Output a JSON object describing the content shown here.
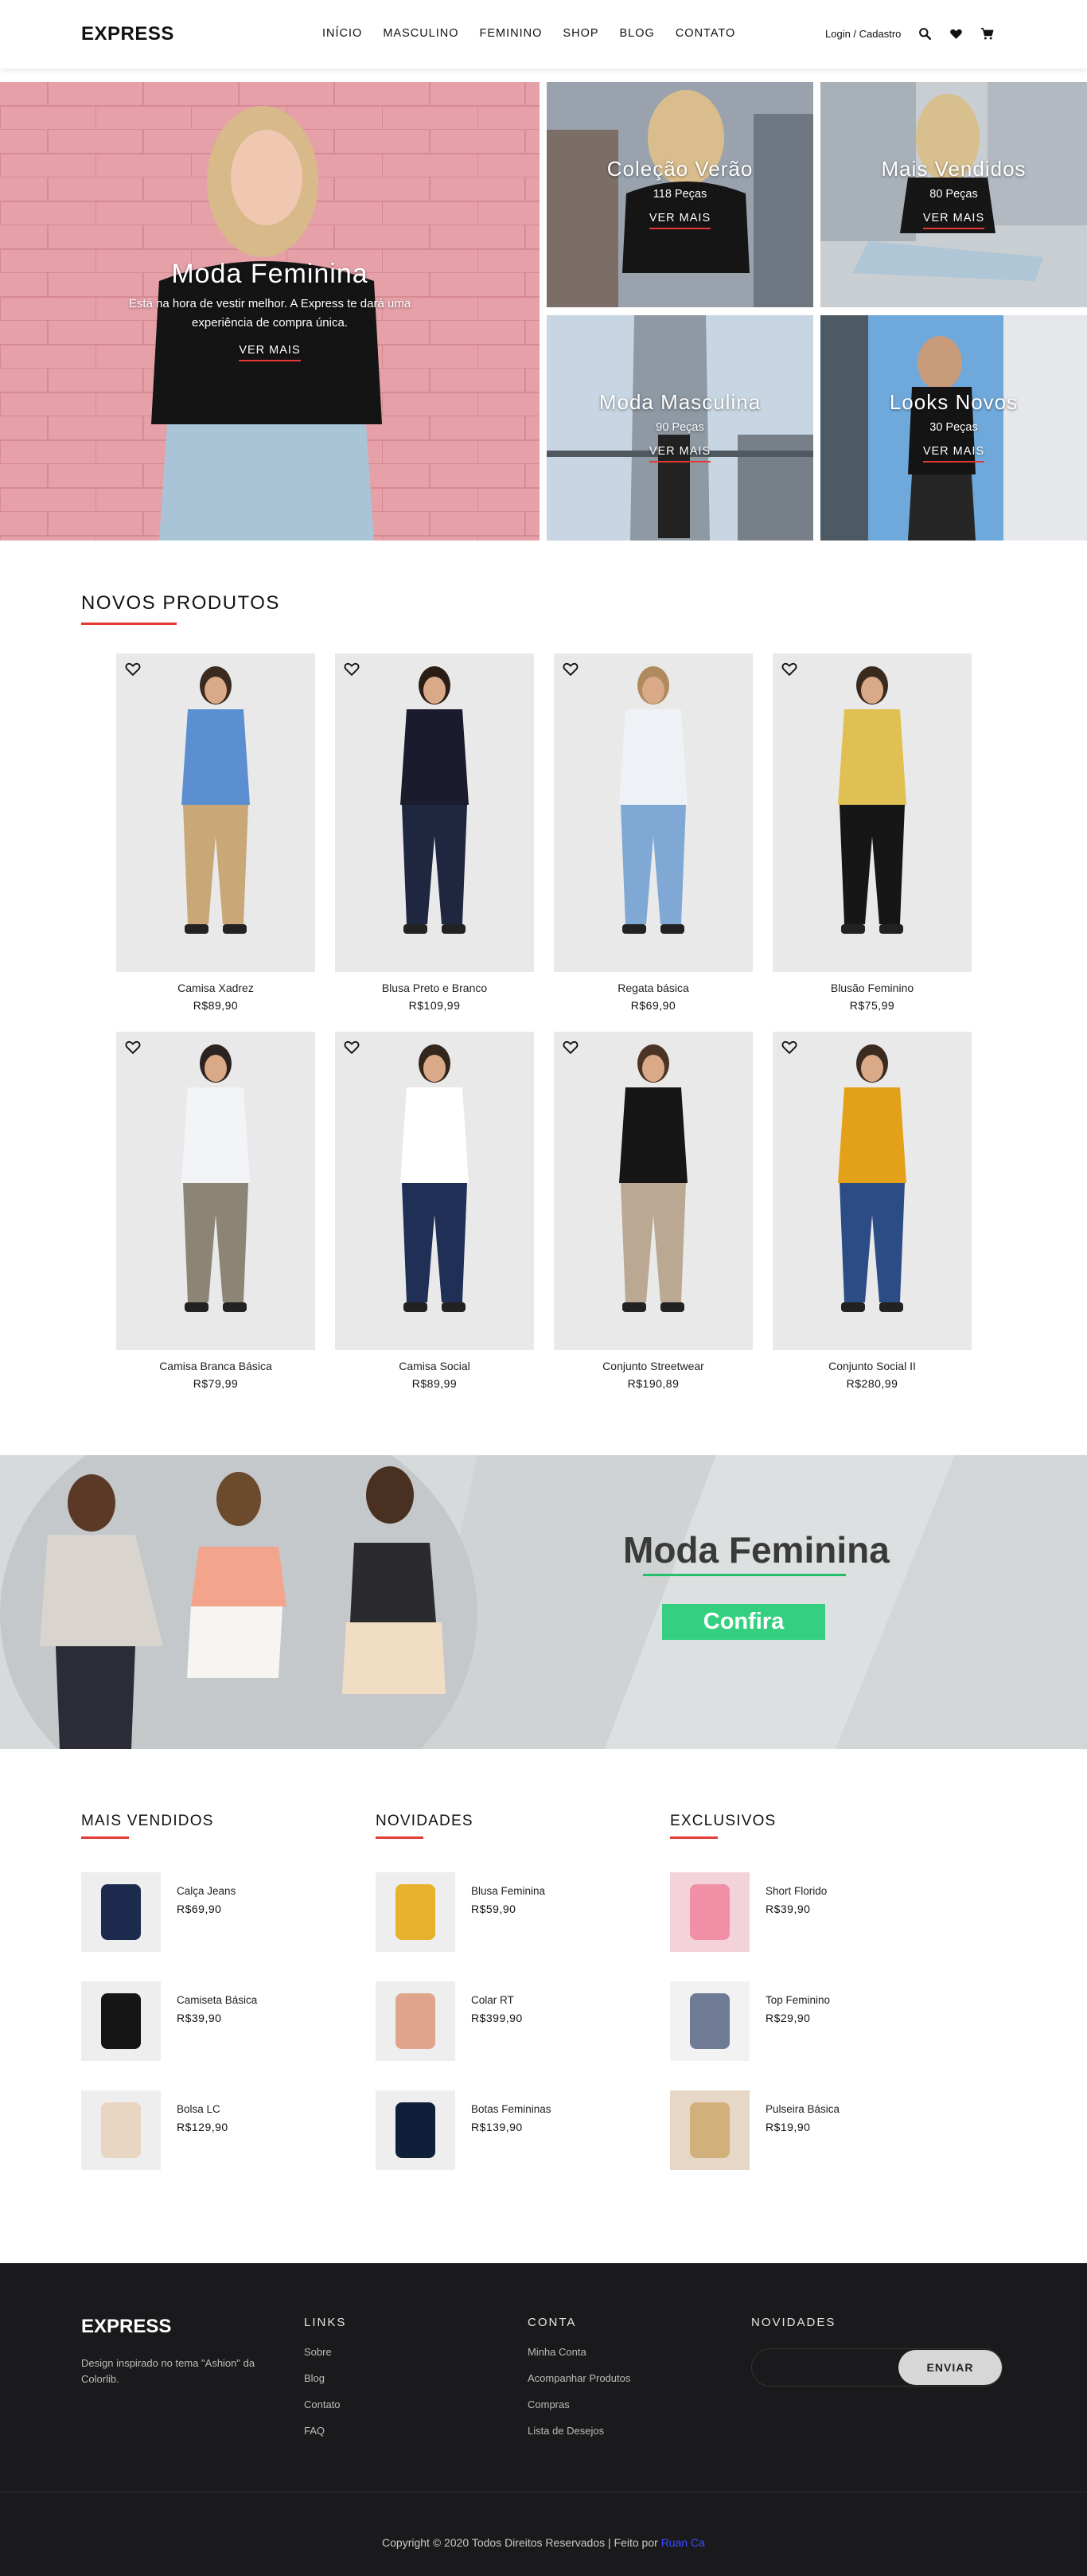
{
  "header": {
    "logo": "EXPRESS",
    "nav": [
      "INÍCIO",
      "MASCULINO",
      "FEMININO",
      "SHOP",
      "BLOG",
      "CONTATO"
    ],
    "login": "Login / Cadastro",
    "icons": [
      "search-icon",
      "heart-icon",
      "cart-icon"
    ]
  },
  "hero": {
    "main": {
      "title": "Moda Feminina",
      "text": "Está na hora de vestir melhor. A Express te dará uma experiência de compra única.",
      "link": "VER MAIS"
    },
    "tiles": [
      {
        "title": "Coleção Verão",
        "count": "118 Peças",
        "link": "VER MAIS"
      },
      {
        "title": "Mais Vendidos",
        "count": "80 Peças",
        "link": "VER MAIS"
      },
      {
        "title": "Moda Masculina",
        "count": "90 Peças",
        "link": "VER MAIS"
      },
      {
        "title": "Looks Novos",
        "count": "30 Peças",
        "link": "VER MAIS"
      }
    ]
  },
  "new_products": {
    "title": "NOVOS PRODUTOS",
    "items": [
      {
        "name": "Camisa Xadrez",
        "price": "R$89,90"
      },
      {
        "name": "Blusa Preto e Branco",
        "price": "R$109,99"
      },
      {
        "name": "Regata básica",
        "price": "R$69,90"
      },
      {
        "name": "Blusão Feminino",
        "price": "R$75,99"
      },
      {
        "name": "Camisa Branca Básica",
        "price": "R$79,99"
      },
      {
        "name": "Camisa Social",
        "price": "R$89,99"
      },
      {
        "name": "Conjunto Streetwear",
        "price": "R$190,89"
      },
      {
        "name": "Conjunto Social II",
        "price": "R$280,99"
      }
    ]
  },
  "banner": {
    "title": "Moda Feminina",
    "button": "Confira",
    "accent": "#35d07f"
  },
  "lists": [
    {
      "title": "MAIS VENDIDOS",
      "items": [
        {
          "name": "Calça Jeans",
          "price": "R$69,90"
        },
        {
          "name": "Camiseta Básica",
          "price": "R$39,90"
        },
        {
          "name": "Bolsa LC",
          "price": "R$129,90"
        }
      ]
    },
    {
      "title": "NOVIDADES",
      "items": [
        {
          "name": "Blusa Feminina",
          "price": "R$59,90"
        },
        {
          "name": "Colar RT",
          "price": "R$399,90"
        },
        {
          "name": "Botas Femininas",
          "price": "R$139,90"
        }
      ]
    },
    {
      "title": "EXCLUSIVOS",
      "items": [
        {
          "name": "Short Florido",
          "price": "R$39,90"
        },
        {
          "name": "Top Feminino",
          "price": "R$29,90"
        },
        {
          "name": "Pulseira Básica",
          "price": "R$19,90"
        }
      ]
    }
  ],
  "footer": {
    "logo": "EXPRESS",
    "description": "Design inspirado no tema \"Ashion\" da Colorlib.",
    "links_title": "LINKS",
    "links": [
      "Sobre",
      "Blog",
      "Contato",
      "FAQ"
    ],
    "account_title": "CONTA",
    "account": [
      "Minha Conta",
      "Acompanhar Produtos",
      "Compras",
      "Lista de Desejos"
    ],
    "newsletter_title": "NOVIDADES",
    "newsletter_button": "ENVIAR",
    "copyright": "Copyright © 2020 Todos Direitos Reservados | Feito por ",
    "credit": "Ruan Ca"
  },
  "colors": {
    "accent_red": "#e53935",
    "footer_bg": "#1a1a1c",
    "banner_green": "#35d07f"
  }
}
